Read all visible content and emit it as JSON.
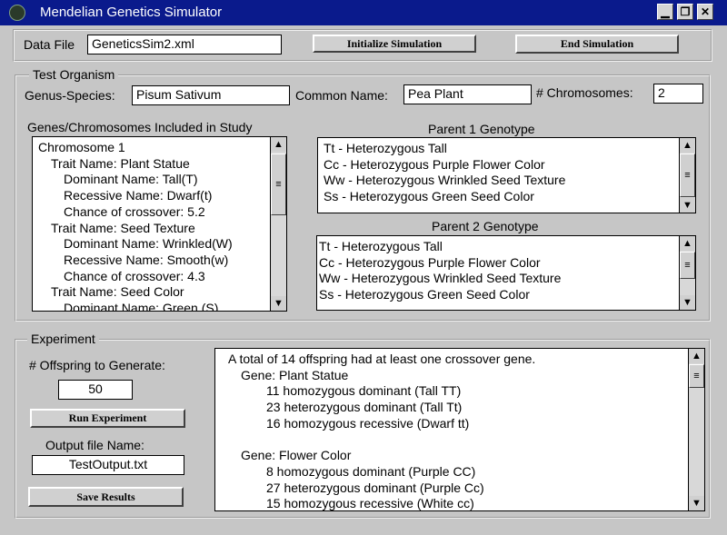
{
  "window": {
    "title": "Mendelian Genetics Simulator",
    "icon": "dna-icon",
    "controls": {
      "minimize": "▁",
      "restore": "❐",
      "close": "✕"
    }
  },
  "data_file": {
    "label": "Data File",
    "value": "GeneticsSim2.xml",
    "initialize_button": "Initialize Simulation",
    "end_button": "End Simulation"
  },
  "test_organism": {
    "legend": "Test Organism",
    "genus_species_label": "Genus-Species:",
    "genus_species_value": "Pisum Sativum",
    "common_name_label": "Common Name:",
    "common_name_value": "Pea Plant",
    "chromosomes_label": "# Chromosomes:",
    "chromosomes_value": "2",
    "genes_list_label": "Genes/Chromosomes Included in Study",
    "genes_list": [
      {
        "text": "Chromosome 1",
        "indent": 0
      },
      {
        "text": "Trait Name: Plant Statue",
        "indent": 1
      },
      {
        "text": "Dominant Name: Tall(T)",
        "indent": 2
      },
      {
        "text": "Recessive Name: Dwarf(t)",
        "indent": 2
      },
      {
        "text": "Chance of crossover: 5.2",
        "indent": 2
      },
      {
        "text": "Trait Name: Seed Texture",
        "indent": 1
      },
      {
        "text": "Dominant Name: Wrinkled(W)",
        "indent": 2
      },
      {
        "text": "Recessive Name: Smooth(w)",
        "indent": 2
      },
      {
        "text": "Chance of crossover: 4.3",
        "indent": 2
      },
      {
        "text": "Trait Name: Seed Color",
        "indent": 1
      },
      {
        "text": "Dominant Name: Green (S)",
        "indent": 2
      }
    ],
    "parent1_label": "Parent 1 Genotype",
    "parent1": [
      "Tt - Heterozygous Tall",
      "Cc - Heterozygous Purple Flower Color",
      "Ww - Heterozygous Wrinkled Seed Texture",
      "Ss - Heterozygous Green Seed Color"
    ],
    "parent2_label": "Parent 2 Genotype",
    "parent2": [
      "Tt - Heterozygous Tall",
      "Cc - Heterozygous Purple Flower Color",
      "Ww - Heterozygous Wrinkled Seed Texture",
      "Ss - Heterozygous Green Seed Color"
    ]
  },
  "experiment": {
    "legend": "Experiment",
    "offspring_label": "# Offspring to Generate:",
    "offspring_value": "50",
    "run_button": "Run Experiment",
    "output_label": "Output file Name:",
    "output_value": "TestOutput.txt",
    "save_button": "Save Results",
    "results": [
      {
        "text": "A total of 14 offspring had at least one crossover gene.",
        "indent": 0
      },
      {
        "text": "Gene: Plant Statue",
        "indent": 1
      },
      {
        "text": "11 homozygous dominant (Tall TT)",
        "indent": 3
      },
      {
        "text": "23 heterozygous dominant (Tall Tt)",
        "indent": 3
      },
      {
        "text": "16 homozygous recessive (Dwarf tt)",
        "indent": 3
      },
      {
        "text": "",
        "indent": 0
      },
      {
        "text": "Gene: Flower Color",
        "indent": 1
      },
      {
        "text": "8 homozygous dominant (Purple CC)",
        "indent": 3
      },
      {
        "text": "27 heterozygous dominant (Purple Cc)",
        "indent": 3
      },
      {
        "text": "15 homozygous recessive (White cc)",
        "indent": 3
      }
    ]
  },
  "scrollbar": {
    "up": "▲",
    "down": "▼",
    "grip": "≡"
  },
  "colors": {
    "titlebar": "#0a1a8c",
    "window_bg": "#c6c6c6",
    "field_bg": "#ffffff"
  }
}
